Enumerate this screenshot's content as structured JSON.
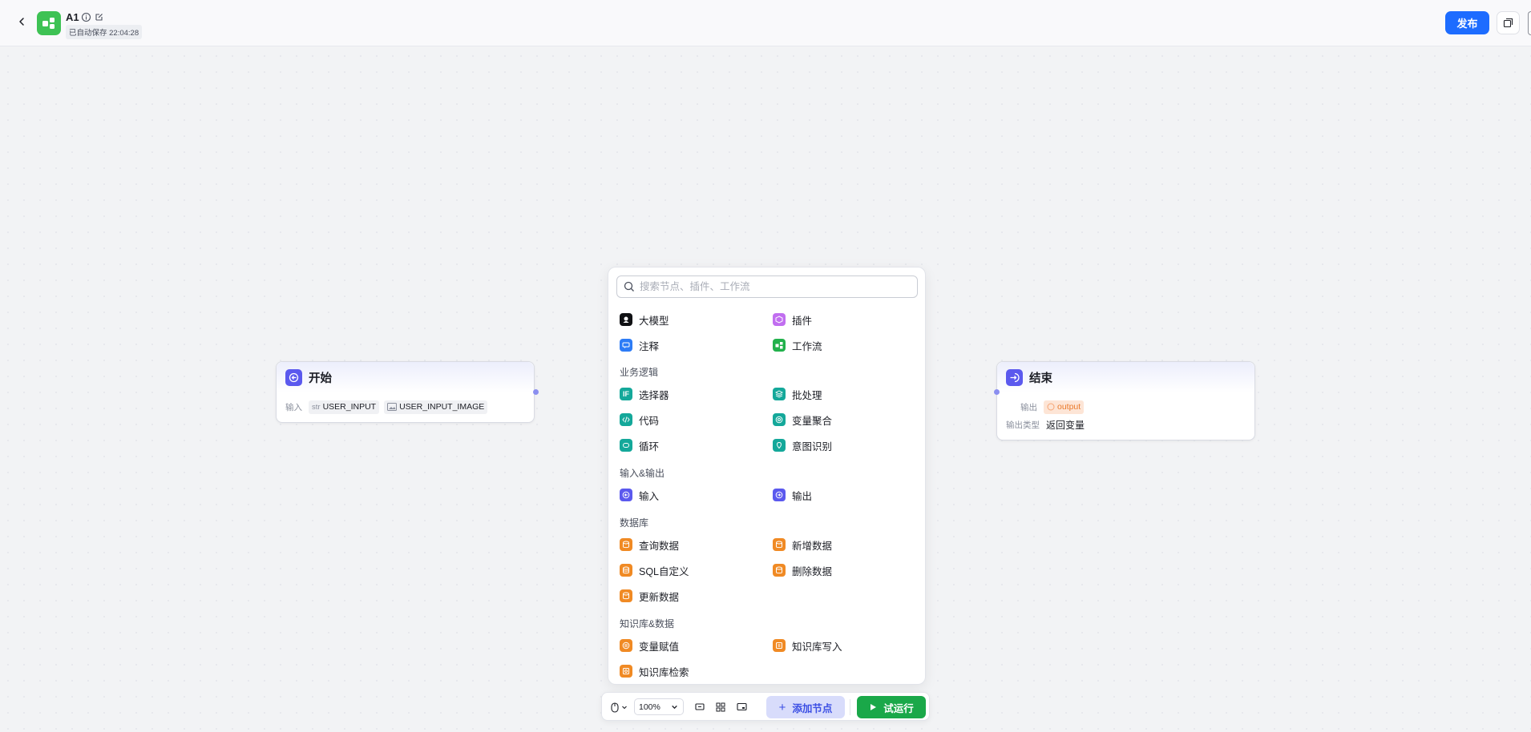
{
  "header": {
    "title": "A1",
    "autosave": "已自动保存 22:04:28",
    "publish_label": "发布",
    "app_icon": "workflow-icon",
    "accent_color": "#1d6cff",
    "app_icon_color": "#3ec254"
  },
  "start_node": {
    "title": "开始",
    "input_label": "输入",
    "params": [
      {
        "prefix": "str",
        "name": "USER_INPUT"
      },
      {
        "prefix": "image",
        "name": "USER_INPUT_IMAGE"
      }
    ]
  },
  "end_node": {
    "title": "结束",
    "output_label": "输出",
    "output_value": "output",
    "output_type_label": "输出类型",
    "output_type_value": "返回变量"
  },
  "panel": {
    "search_placeholder": "搜索节点、插件、工作流",
    "top_items": [
      {
        "label": "大模型",
        "icon": "llm-icon"
      },
      {
        "label": "插件",
        "icon": "plugin-icon"
      },
      {
        "label": "注释",
        "icon": "comment-icon"
      },
      {
        "label": "工作流",
        "icon": "workflow-icon"
      }
    ],
    "categories": [
      {
        "name": "业务逻辑",
        "items": [
          {
            "label": "选择器",
            "icon": "if-icon"
          },
          {
            "label": "批处理",
            "icon": "batch-icon"
          },
          {
            "label": "代码",
            "icon": "code-icon"
          },
          {
            "label": "变量聚合",
            "icon": "aggregate-icon"
          },
          {
            "label": "循环",
            "icon": "loop-icon"
          },
          {
            "label": "意图识别",
            "icon": "intent-icon"
          }
        ]
      },
      {
        "name": "输入&输出",
        "items": [
          {
            "label": "输入",
            "icon": "input-icon"
          },
          {
            "label": "输出",
            "icon": "output-icon"
          }
        ]
      },
      {
        "name": "数据库",
        "items": [
          {
            "label": "查询数据",
            "icon": "db-query-icon"
          },
          {
            "label": "新增数据",
            "icon": "db-insert-icon"
          },
          {
            "label": "SQL自定义",
            "icon": "db-sql-icon"
          },
          {
            "label": "删除数据",
            "icon": "db-delete-icon"
          },
          {
            "label": "更新数据",
            "icon": "db-update-icon"
          }
        ]
      },
      {
        "name": "知识库&数据",
        "items": [
          {
            "label": "变量赋值",
            "icon": "variable-assign-icon"
          },
          {
            "label": "知识库写入",
            "icon": "kb-write-icon"
          },
          {
            "label": "知识库检索",
            "icon": "kb-search-icon"
          }
        ]
      }
    ]
  },
  "toolbar": {
    "zoom": "100%",
    "add_node_label": "添加节点",
    "run_label": "试运行"
  }
}
